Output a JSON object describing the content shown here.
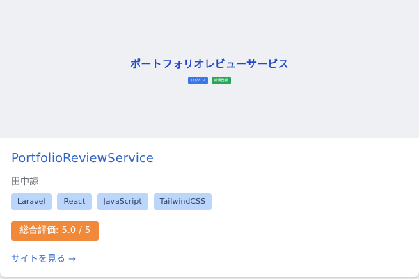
{
  "preview": {
    "title": "ポートフォリオレビューサービス",
    "login_label": "ログイン",
    "register_label": "新規登録"
  },
  "project": {
    "title": "PortfolioReviewService",
    "author": "田中諒",
    "tags": [
      "Laravel",
      "React",
      "JavaScript",
      "TailwindCSS"
    ],
    "rating_label": "総合評価: 5.0 / 5",
    "link_label": "サイトを見る →"
  },
  "colors": {
    "title_blue": "#2f63c7",
    "tag_bg": "#bcd6fb",
    "rating_orange": "#f08a3a",
    "login_blue": "#3b76ea",
    "register_green": "#22a857"
  }
}
